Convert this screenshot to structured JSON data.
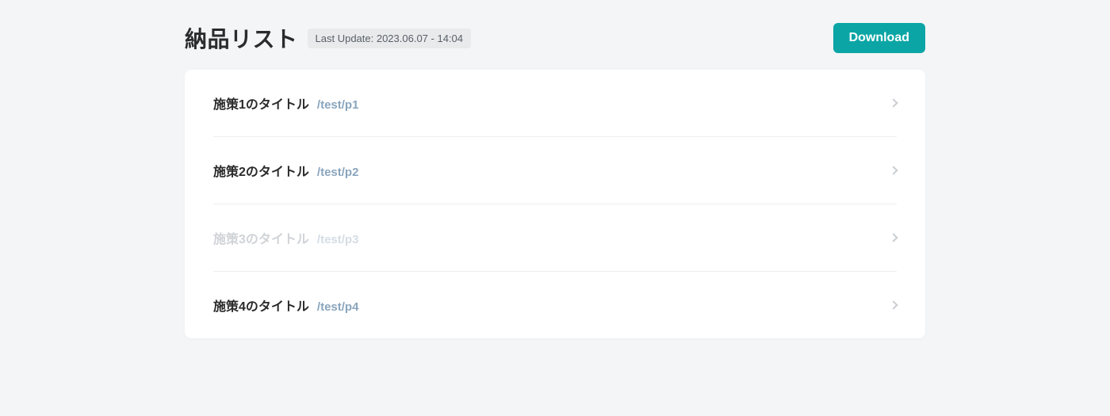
{
  "header": {
    "title": "納品リスト",
    "last_update": "Last Update: 2023.06.07 - 14:04",
    "download_label": "Download"
  },
  "items": [
    {
      "title": "施策1のタイトル",
      "path": "/test/p1",
      "faded": false
    },
    {
      "title": "施策2のタイトル",
      "path": "/test/p2",
      "faded": false
    },
    {
      "title": "施策3のタイトル",
      "path": "/test/p3",
      "faded": true
    },
    {
      "title": "施策4のタイトル",
      "path": "/test/p4",
      "faded": false
    }
  ]
}
